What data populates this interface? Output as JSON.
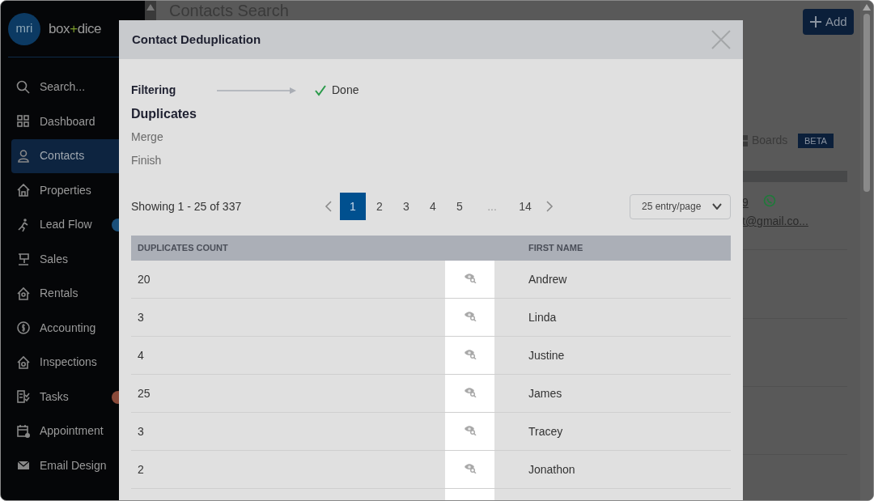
{
  "sidebar": {
    "logo_mark": "mri",
    "brand": [
      {
        "text": "box",
        "color": "#9a9a9a"
      },
      {
        "text": "+",
        "color": "#7a9a2a"
      },
      {
        "text": "dice",
        "color": "#9a9a9a"
      }
    ],
    "items": [
      {
        "label": "Search...",
        "selected": false
      },
      {
        "label": "Dashboard",
        "selected": false
      },
      {
        "label": "Contacts",
        "selected": true
      },
      {
        "label": "Properties",
        "selected": false
      },
      {
        "label": "Lead Flow",
        "selected": false,
        "badge": {
          "color": "#1a4f7a"
        }
      },
      {
        "label": "Sales",
        "selected": false
      },
      {
        "label": "Rentals",
        "selected": false
      },
      {
        "label": "Accounting",
        "selected": false
      },
      {
        "label": "Inspections",
        "selected": false
      },
      {
        "label": "Tasks",
        "selected": false,
        "badge": {
          "color": "#8a4a3a"
        }
      },
      {
        "label": "Appointment",
        "selected": false
      },
      {
        "label": "Email Design",
        "selected": false
      }
    ]
  },
  "page": {
    "title": "Contacts Search",
    "add_button": "Add",
    "boards": "Boards",
    "beta_badge": "BETA",
    "row_number": "9",
    "row_email": "t@gmail.co..."
  },
  "dialog": {
    "title": "Contact Deduplication",
    "steps": [
      {
        "label": "Filtering",
        "completed": true,
        "current": false,
        "result": "Done"
      },
      {
        "label": "Duplicates",
        "completed": false,
        "current": true
      },
      {
        "label": "Merge",
        "completed": false,
        "current": false
      },
      {
        "label": "Finish",
        "completed": false,
        "current": false
      }
    ],
    "summary": "Showing 1 - 25 of 337",
    "pages": [
      {
        "label": "1",
        "selected": true
      },
      {
        "label": "2",
        "selected": false
      },
      {
        "label": "3",
        "selected": false
      },
      {
        "label": "4",
        "selected": false
      },
      {
        "label": "5",
        "selected": false
      },
      {
        "label": "...",
        "selected": false,
        "kind": "gap"
      },
      {
        "label": "14",
        "selected": false
      }
    ],
    "page_size": "25 entry/page",
    "table": {
      "columns": [
        "DUPLICATES COUNT",
        "FIRST NAME"
      ],
      "rows": [
        {
          "count": "20",
          "first_name": "Andrew"
        },
        {
          "count": "3",
          "first_name": "Linda"
        },
        {
          "count": "4",
          "first_name": "Justine"
        },
        {
          "count": "25",
          "first_name": "James"
        },
        {
          "count": "3",
          "first_name": "Tracey"
        },
        {
          "count": "2",
          "first_name": "Jonathon"
        }
      ]
    }
  }
}
